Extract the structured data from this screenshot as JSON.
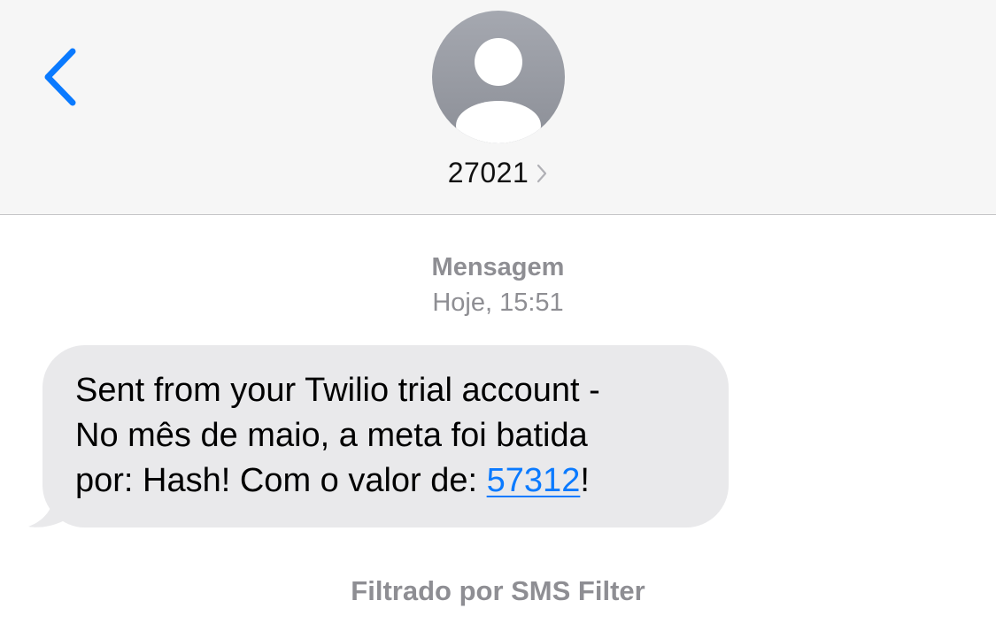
{
  "header": {
    "back_icon": "chevron-left-icon",
    "avatar_icon": "person-silhouette-icon",
    "contact_name": "27021",
    "contact_chevron_icon": "chevron-right-icon"
  },
  "conversation": {
    "service_label": "Mensagem",
    "timestamp": "Hoje, 15:51",
    "message": {
      "line1": "Sent from your Twilio trial account -",
      "line2": "No mês de maio, a meta foi batida",
      "line3_prefix": "por: Hash! Com o valor de: ",
      "line3_link": "57312",
      "line3_suffix": "!"
    },
    "filter_note": "Filtrado por SMS Filter"
  },
  "colors": {
    "accent": "#0a7aff",
    "header_bg": "#f6f6f6",
    "bubble_bg": "#e9e9eb",
    "meta_text": "#8e8e93"
  }
}
